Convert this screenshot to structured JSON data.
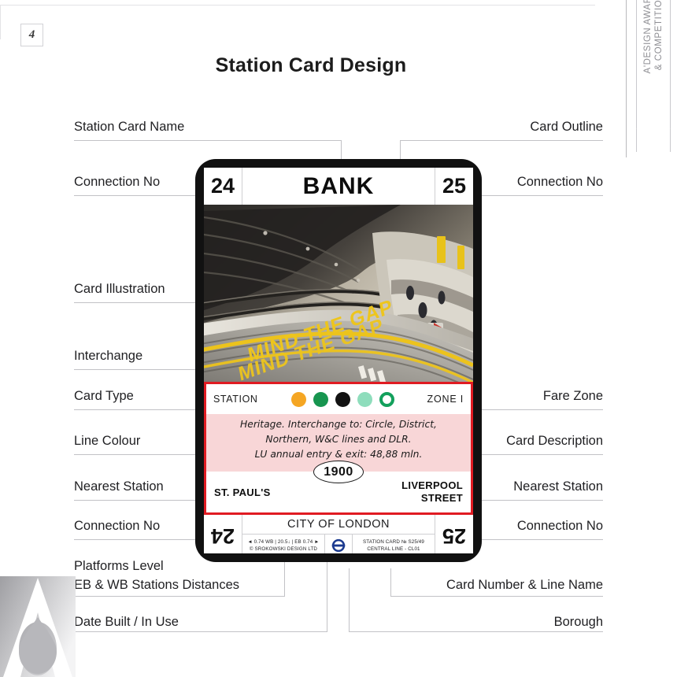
{
  "page": {
    "number": "4",
    "title": "Station Card Design"
  },
  "award_ribbon": {
    "line1": "A'DESIGN AWARD",
    "line2": "& COMPETITION"
  },
  "annotations": {
    "left": [
      {
        "label": "Station Card Name"
      },
      {
        "label": "Connection No"
      },
      {
        "label": "Card Illustration"
      },
      {
        "label": "Interchange"
      },
      {
        "label": "Card Type"
      },
      {
        "label": "Line Colour"
      },
      {
        "label": "Nearest Station"
      },
      {
        "label": "Connection No"
      },
      {
        "label": "Platforms Level"
      },
      {
        "label": "EB & WB Stations Distances"
      },
      {
        "label": "Date Built / In Use"
      }
    ],
    "right": [
      {
        "label": "Card Outline"
      },
      {
        "label": "Connection No"
      },
      {
        "label": "Fare Zone"
      },
      {
        "label": "Card Description"
      },
      {
        "label": "Nearest Station"
      },
      {
        "label": "Connection No"
      },
      {
        "label": "Card Number & Line Name"
      },
      {
        "label": "Borough"
      }
    ]
  },
  "card": {
    "name": "BANK",
    "connection_left": "24",
    "connection_right": "25",
    "card_type": "STATION",
    "fare_zone": "ZONE I",
    "description_lines": [
      "Heritage. Interchange to: Circle, District,",
      "Northern, W&C lines and DLR.",
      "LU annual entry & exit: 48,88 mln."
    ],
    "date_built": "1900",
    "nearest_station_left": "ST. PAUL'S",
    "nearest_station_right_line1": "LIVERPOOL",
    "nearest_station_right_line2": "STREET",
    "borough": "CITY OF LONDON",
    "distances_line": "◄ 0.74 WB | 20.5↓ | EB 0.74 ►",
    "copyright_line": "© SROKOWSKI DESIGN LTD",
    "card_number_line": "STATION CARD № S25/49",
    "line_name_line": "CENTRAL LINE - CL01",
    "roundel_icon": "tfl-roundel-icon",
    "line_colours": [
      {
        "name": "circle-line-dot",
        "color": "#F5A623",
        "style": "solid"
      },
      {
        "name": "district-line-dot",
        "color": "#17954F",
        "style": "solid"
      },
      {
        "name": "northern-line-dot",
        "color": "#121212",
        "style": "solid"
      },
      {
        "name": "waterloo-city-line-dot",
        "color": "#8EDDBC",
        "style": "solid"
      },
      {
        "name": "dlr-line-dot",
        "color": "#13A05C",
        "style": "ring"
      }
    ],
    "accent_border_color": "#E01B22",
    "description_bg_color": "#F8D6D7"
  }
}
